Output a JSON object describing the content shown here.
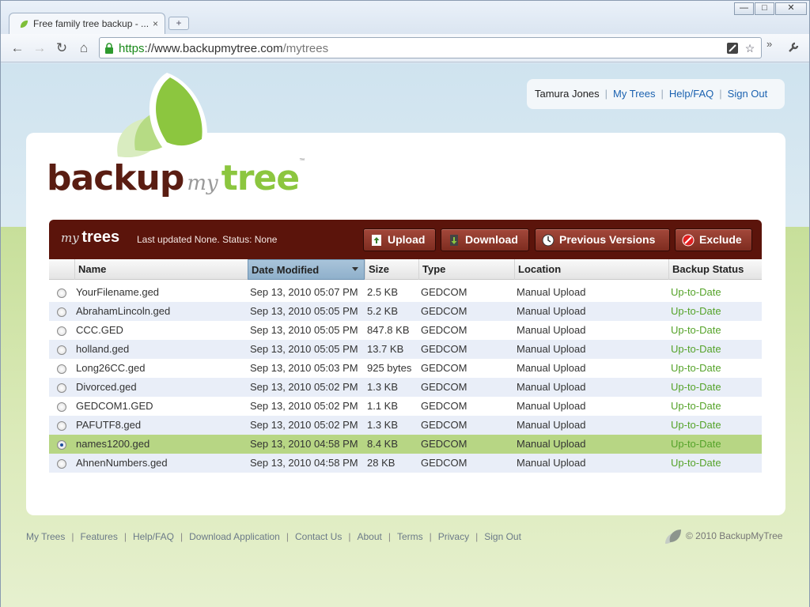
{
  "browser": {
    "tab_title": "Free family tree backup - ...",
    "tab_close": "×",
    "new_tab": "+",
    "url_scheme": "https",
    "url_sep": "://",
    "url_host": "www.backupmytree.com",
    "url_path": "/mytrees",
    "window_controls": {
      "minimize": "—",
      "maximize": "□",
      "close": "✕"
    },
    "nav": {
      "back": "←",
      "forward": "→",
      "reload": "↻",
      "home": "⌂"
    }
  },
  "user_nav": {
    "user_name": "Tamura Jones",
    "sep": "|",
    "links": [
      "My Trees",
      "Help/FAQ",
      "Sign Out"
    ]
  },
  "logo": {
    "part1": "backup",
    "part2": "my",
    "part3": "tree",
    "tm": "™"
  },
  "panel": {
    "title_my": "my",
    "title_trees": "trees",
    "status": "Last updated None. Status: None",
    "buttons": {
      "upload": "Upload",
      "download": "Download",
      "previous_versions": "Previous Versions",
      "exclude": "Exclude"
    }
  },
  "table": {
    "columns": [
      "Name",
      "Date Modified",
      "Size",
      "Type",
      "Location",
      "Backup Status"
    ],
    "rows": [
      {
        "name": "YourFilename.ged",
        "date": "Sep 13, 2010 05:07 PM",
        "size": "2.5 KB",
        "type": "GEDCOM",
        "location": "Manual Upload",
        "status": "Up-to-Date",
        "selected": false
      },
      {
        "name": "AbrahamLincoln.ged",
        "date": "Sep 13, 2010 05:05 PM",
        "size": "5.2 KB",
        "type": "GEDCOM",
        "location": "Manual Upload",
        "status": "Up-to-Date",
        "selected": false
      },
      {
        "name": "CCC.GED",
        "date": "Sep 13, 2010 05:05 PM",
        "size": "847.8 KB",
        "type": "GEDCOM",
        "location": "Manual Upload",
        "status": "Up-to-Date",
        "selected": false
      },
      {
        "name": "holland.ged",
        "date": "Sep 13, 2010 05:05 PM",
        "size": "13.7 KB",
        "type": "GEDCOM",
        "location": "Manual Upload",
        "status": "Up-to-Date",
        "selected": false
      },
      {
        "name": "Long26CC.ged",
        "date": "Sep 13, 2010 05:03 PM",
        "size": "925 bytes",
        "type": "GEDCOM",
        "location": "Manual Upload",
        "status": "Up-to-Date",
        "selected": false
      },
      {
        "name": "Divorced.ged",
        "date": "Sep 13, 2010 05:02 PM",
        "size": "1.3 KB",
        "type": "GEDCOM",
        "location": "Manual Upload",
        "status": "Up-to-Date",
        "selected": false
      },
      {
        "name": "GEDCOM1.GED",
        "date": "Sep 13, 2010 05:02 PM",
        "size": "1.1 KB",
        "type": "GEDCOM",
        "location": "Manual Upload",
        "status": "Up-to-Date",
        "selected": false
      },
      {
        "name": "PAFUTF8.ged",
        "date": "Sep 13, 2010 05:02 PM",
        "size": "1.3 KB",
        "type": "GEDCOM",
        "location": "Manual Upload",
        "status": "Up-to-Date",
        "selected": false
      },
      {
        "name": "names1200.ged",
        "date": "Sep 13, 2010 04:58 PM",
        "size": "8.4 KB",
        "type": "GEDCOM",
        "location": "Manual Upload",
        "status": "Up-to-Date",
        "selected": true
      },
      {
        "name": "AhnenNumbers.ged",
        "date": "Sep 13, 2010 04:58 PM",
        "size": "28 KB",
        "type": "GEDCOM",
        "location": "Manual Upload",
        "status": "Up-to-Date",
        "selected": false
      }
    ]
  },
  "footer": {
    "sep": "|",
    "links": [
      "My Trees",
      "Features",
      "Help/FAQ",
      "Download Application",
      "Contact Us",
      "About",
      "Terms",
      "Privacy",
      "Sign Out"
    ],
    "copyright": "© 2010 BackupMyTree"
  },
  "colors": {
    "brand_brown": "#5b140b",
    "brand_green": "#8cc63f",
    "status_green": "#55a32a",
    "selected_row": "#b7d684",
    "link_blue": "#1b62b0"
  }
}
